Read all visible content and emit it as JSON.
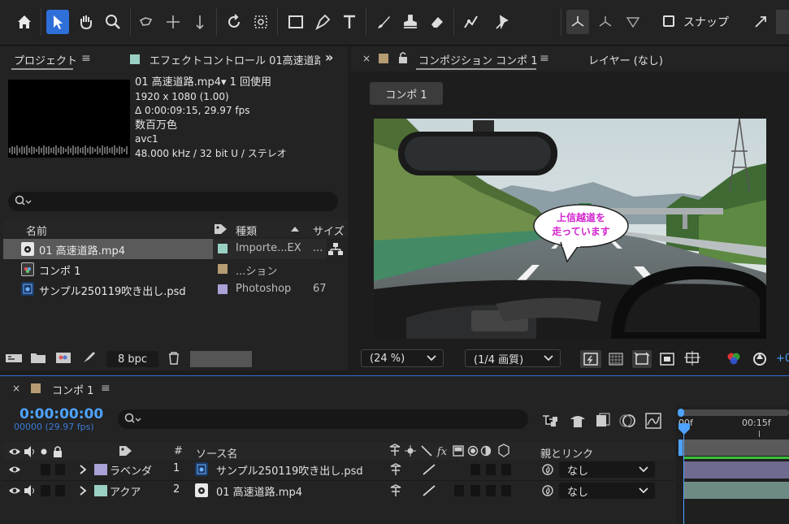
{
  "colors": {
    "accent": "#2f6fd8",
    "timecode": "#4da3ff",
    "lavender": "#a9a2d6",
    "aqua": "#9ad0c4",
    "tan": "#b59c72",
    "playhead": "#4da3ff"
  },
  "toolbar": {
    "snap_label": "スナップ"
  },
  "project_panel": {
    "tab_label": "プロジェクト",
    "effects_tab_label": "エフェクトコントロール 01高速道路",
    "overflow_icon": "»",
    "info": {
      "filename": "01 高速道路.mp4▾ 1 回使用",
      "resolution": "1920 x 1080 (1.00)",
      "duration": "Δ 0:00:09:15, 29.97 fps",
      "colors": "数百万色",
      "codec": "avc1",
      "audio": "48.000 kHz / 32 bit U / ステレオ"
    },
    "columns": {
      "name": "名前",
      "type": "種類",
      "size": "サイズ"
    },
    "items": [
      {
        "name": "01 高速道路.mp4",
        "type": "Importe...EX",
        "size": "...",
        "icon": "video-file-icon"
      },
      {
        "name": "コンポ 1",
        "type": "...ション",
        "size": "",
        "icon": "composition-icon"
      },
      {
        "name": "サンプル250119吹き出し.psd",
        "type": "Photoshop",
        "size": "67",
        "icon": "psd-file-icon"
      }
    ],
    "bpc_label": "8 bpc"
  },
  "comp_panel": {
    "tab_label": "コンポジション コンポ 1",
    "layer_tab_label": "レイヤー (なし)",
    "comp_button": "コンポ 1",
    "bubble_line1": "上信越道を",
    "bubble_line2": "走っています",
    "zoom": "(24 %)",
    "quality": "(1/4 画質)",
    "offset_label": "+0"
  },
  "timeline": {
    "tab_label": "コンポ 1",
    "timecode": "0:00:00:00",
    "fps_label": "00000 (29.97 fps)",
    "col_source": "ソース名",
    "col_num": "#",
    "col_parent": "親とリンク",
    "ruler_start": "00f",
    "ruler_mid": "00:15f",
    "layers": [
      {
        "num": "1",
        "label": "ラベンダ",
        "source": "サンプル250119吹き出し.psd",
        "parent": "なし"
      },
      {
        "num": "2",
        "label": "アクア",
        "source": "01 高速道路.mp4",
        "parent": "なし"
      }
    ]
  }
}
